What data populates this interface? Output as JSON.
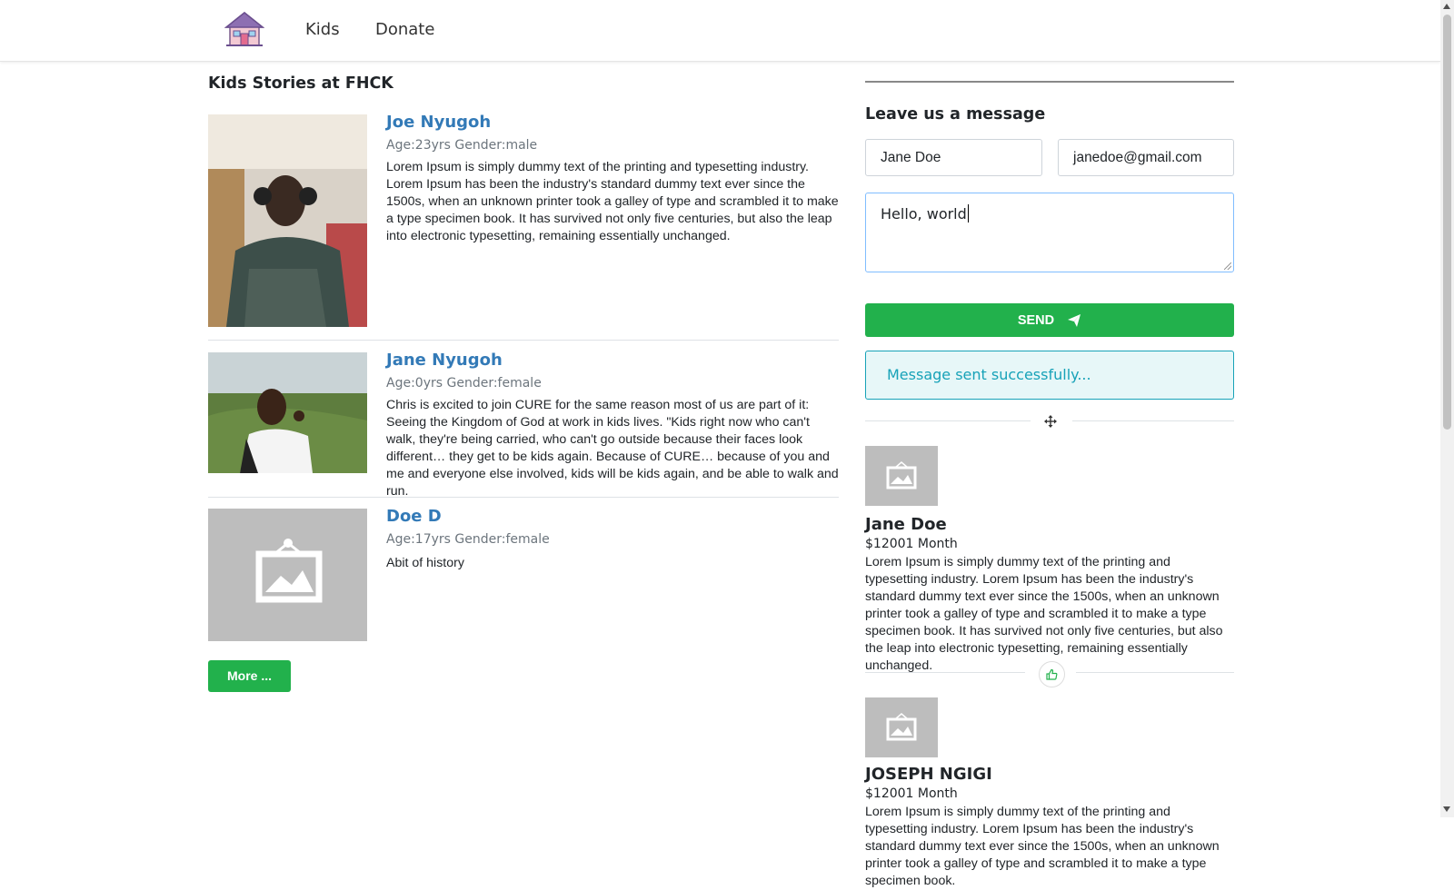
{
  "nav": {
    "logo_icon": "house-icon",
    "links": [
      "Kids",
      "Donate"
    ]
  },
  "stories": {
    "title": "Kids Stories at FHCK",
    "kids": [
      {
        "name": "Joe Nyugoh",
        "meta": "Age:23yrs Gender:male",
        "story": "Lorem Ipsum is simply dummy text of the printing and typesetting industry. Lorem Ipsum has been the industry's standard dummy text ever since the 1500s, when an unknown printer took a galley of type and scrambled it to make a type specimen book. It has survived not only five centuries, but also the leap into electronic typesetting, remaining essentially unchanged.",
        "photo": "photo"
      },
      {
        "name": "Jane Nyugoh",
        "meta": "Age:0yrs Gender:female",
        "story": "Chris is excited to join CURE for the same reason most of us are part of it: Seeing the Kingdom of God at work in kids lives. \"Kids right now who can't walk, they're being carried, who can't go outside because their faces look different… they get to be kids again. Because of CURE… because of you and me and everyone else involved, kids will be kids again, and be able to walk and run.",
        "photo": "photo"
      },
      {
        "name": "Doe D",
        "meta": "Age:17yrs Gender:female",
        "story": "Abit of history",
        "photo": "placeholder-image-icon"
      }
    ],
    "more_label": "More ..."
  },
  "message_form": {
    "title": "Leave us a message",
    "name_value": "Jane Doe",
    "email_value": "janedoe@gmail.com",
    "message_value": "Hello, world",
    "send_label": "SEND",
    "send_icon": "paper-plane-icon",
    "success_text": "Message sent successfully..."
  },
  "donors": [
    {
      "name": "Jane Doe",
      "amount": "$12001 Month",
      "text": "Lorem Ipsum is simply dummy text of the printing and typesetting industry. Lorem Ipsum has been the industry's standard dummy text ever since the 1500s, when an unknown printer took a galley of type and scrambled it to make a type specimen book. It has survived not only five centuries, but also the leap into electronic typesetting, remaining essentially unchanged."
    },
    {
      "name": "JOSEPH NGIGI",
      "amount": "$12001 Month",
      "text": "Lorem Ipsum is simply dummy text of the printing and typesetting industry. Lorem Ipsum has been the industry's standard dummy text ever since the 1500s, when an unknown printer took a galley of type and scrambled it to make a type specimen book."
    }
  ],
  "colors": {
    "accent_green": "#22b14c",
    "link_blue": "#337ab7",
    "info_teal": "#17a2b8"
  }
}
